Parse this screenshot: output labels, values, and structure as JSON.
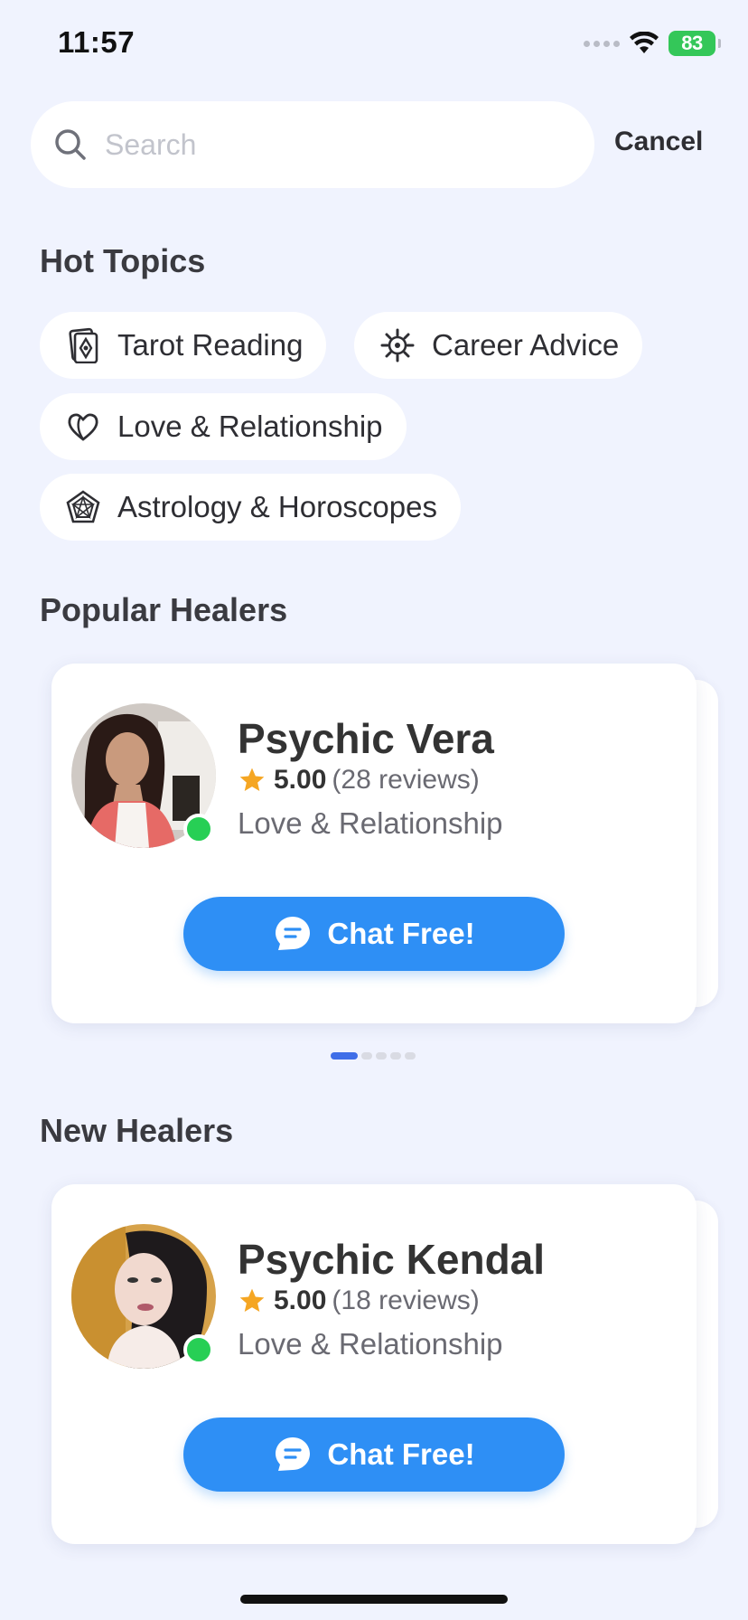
{
  "status_bar": {
    "time": "11:57",
    "battery": "83"
  },
  "search": {
    "placeholder": "Search",
    "cancel_label": "Cancel"
  },
  "hot_topics": {
    "title": "Hot Topics",
    "items": [
      {
        "label": "Tarot Reading",
        "icon": "tarot-card-icon"
      },
      {
        "label": "Career Advice",
        "icon": "career-gear-icon"
      },
      {
        "label": "Love & Relationship",
        "icon": "heart-icon"
      },
      {
        "label": "Astrology & Horoscopes",
        "icon": "astrology-pentagon-icon"
      }
    ]
  },
  "popular_healers": {
    "title": "Popular Healers",
    "card": {
      "name": "Psychic Vera",
      "rating": "5.00",
      "reviews": "(28 reviews)",
      "specialty": "Love & Relationship",
      "cta": "Chat Free!",
      "online": true
    },
    "page_count": 5,
    "active_page": 1
  },
  "new_healers": {
    "title": "New Healers",
    "card": {
      "name": "Psychic Kendal",
      "rating": "5.00",
      "reviews": "(18 reviews)",
      "specialty": "Love & Relationship",
      "cta": "Chat Free!",
      "online": true
    }
  },
  "colors": {
    "background": "#f0f3fe",
    "accent": "#2e8ff5",
    "online": "#27cf55",
    "star": "#f5a623",
    "pager_active": "#3f6ee8"
  }
}
